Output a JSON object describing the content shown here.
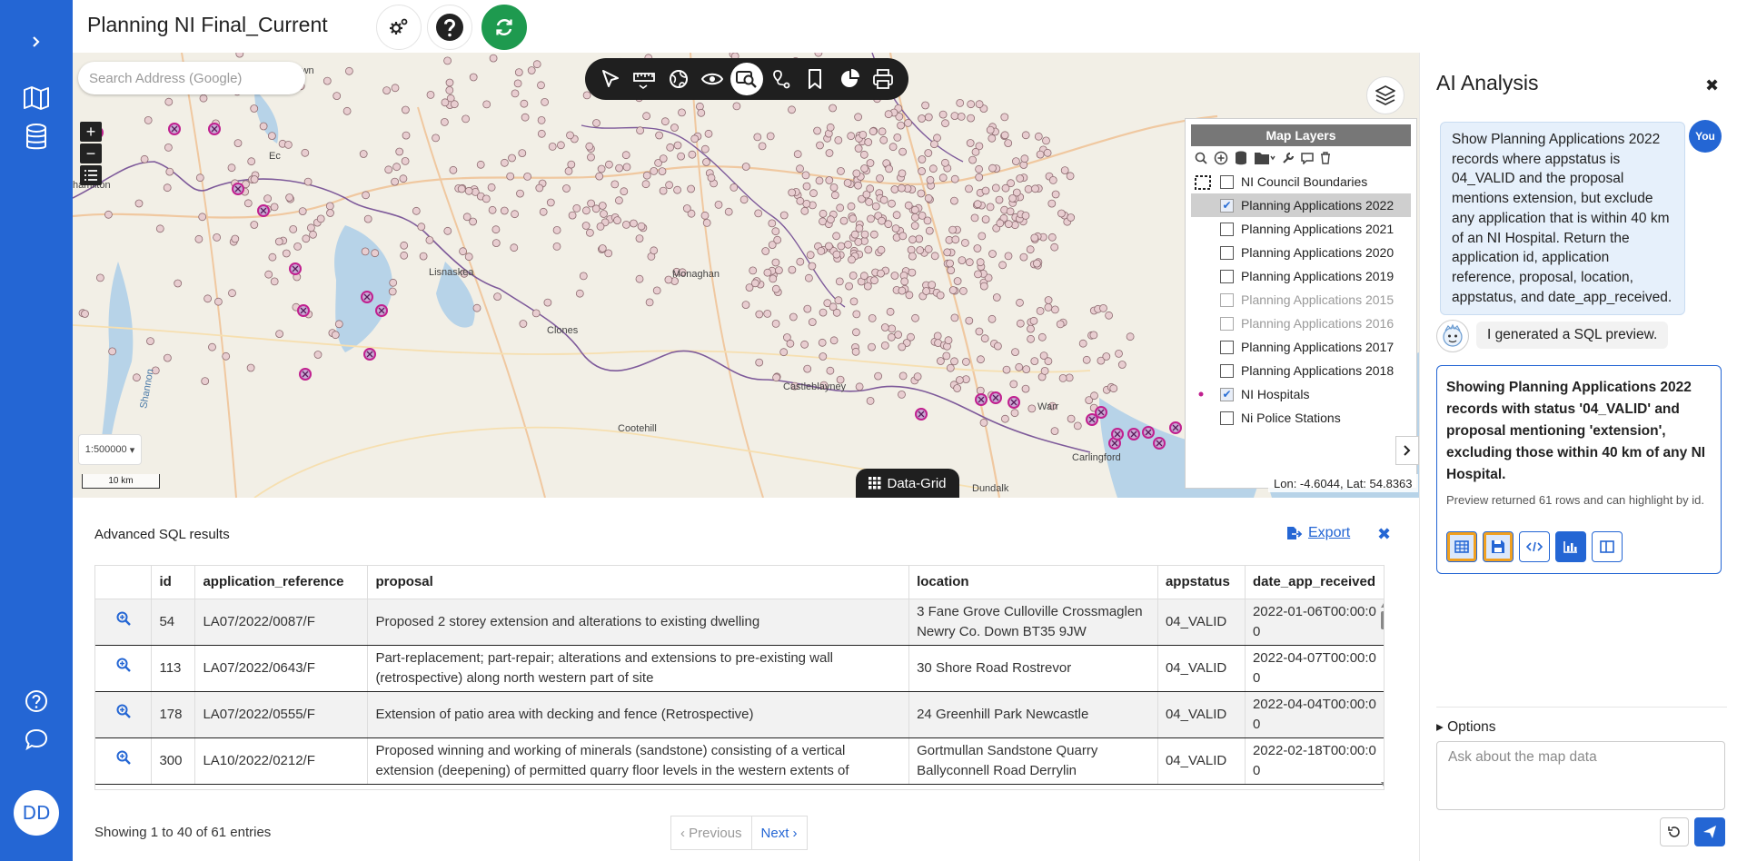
{
  "app": {
    "title": "Planning NI Final_Current",
    "avatar_initials": "DD"
  },
  "colors": {
    "accent": "#2466d4",
    "refresh": "#1e9a4f",
    "hospital": "#c0208f",
    "application_dot": "#e8cdd0"
  },
  "icons": {
    "rail": [
      "chevron-right-icon",
      "map-icon",
      "database-icon",
      "help-icon",
      "chat-icon"
    ],
    "header": [
      "settings-icon",
      "help-icon",
      "refresh-icon"
    ],
    "toolbar": [
      "select-pointer-icon",
      "measure-icon",
      "globe-icon",
      "eye-icon",
      "zoom-search-icon",
      "route-pin-icon",
      "bookmark-icon",
      "pie-chart-icon",
      "print-icon"
    ]
  },
  "map": {
    "search_placeholder": "Search Address (Google)",
    "scale": "1:500000",
    "scale_bar": "10 km",
    "coords": "Lon: -4.6044, Lat: 54.8363",
    "datagrid_label": "Data-Grid",
    "place_labels": [
      {
        "name": "Irvinestown"
      },
      {
        "name": "Ec"
      },
      {
        "name": "hamilton"
      },
      {
        "name": "Lisnaskea"
      },
      {
        "name": "Monaghan"
      },
      {
        "name": "Clones"
      },
      {
        "name": "Castleblayney"
      },
      {
        "name": "Cootehill"
      },
      {
        "name": "Dundalk"
      },
      {
        "name": "Carlingford"
      },
      {
        "name": "Warr"
      },
      {
        "name": "Shannon"
      }
    ]
  },
  "layers": {
    "title": "Map Layers",
    "tool_icons": [
      "search-icon",
      "add-layer-icon",
      "stack-icon",
      "folder-icon",
      "wrench-icon",
      "comment-icon",
      "trash-icon"
    ],
    "items": [
      {
        "label": "NI Council Boundaries",
        "checked": false,
        "dim": false,
        "marker": "boundary"
      },
      {
        "label": "Planning Applications 2022",
        "checked": true,
        "dim": false,
        "selected": true
      },
      {
        "label": "Planning Applications 2021",
        "checked": false,
        "dim": false
      },
      {
        "label": "Planning Applications 2020",
        "checked": false,
        "dim": false
      },
      {
        "label": "Planning Applications 2019",
        "checked": false,
        "dim": false
      },
      {
        "label": "Planning Applications 2015",
        "checked": false,
        "dim": true
      },
      {
        "label": "Planning Applications 2016",
        "checked": false,
        "dim": true
      },
      {
        "label": "Planning Applications 2017",
        "checked": false,
        "dim": false
      },
      {
        "label": "Planning Applications 2018",
        "checked": false,
        "dim": false
      },
      {
        "label": "NI Hospitals",
        "checked": true,
        "dim": false,
        "marker": "dot"
      },
      {
        "label": "Ni Police Stations",
        "checked": false,
        "dim": false
      }
    ]
  },
  "results": {
    "title": "Advanced SQL results",
    "export_label": "Export",
    "columns": [
      "",
      "id",
      "application_reference",
      "proposal",
      "location",
      "appstatus",
      "date_app_received"
    ],
    "rows": [
      {
        "id": "54",
        "application_reference": "LA07/2022/0087/F",
        "proposal": "Proposed 2 storey extension and alterations to existing dwelling",
        "location": "3 Fane Grove Culloville Crossmaglen Newry Co. Down BT35 9JW",
        "appstatus": "04_VALID",
        "date_app_received": "2022-01-06T00:00:00"
      },
      {
        "id": "113",
        "application_reference": "LA07/2022/0643/F",
        "proposal": "Part-replacement; part-repair; alterations and extensions to pre-existing wall (retrospective) along north western part of site",
        "location": "30 Shore Road Rostrevor",
        "appstatus": "04_VALID",
        "date_app_received": "2022-04-07T00:00:00"
      },
      {
        "id": "178",
        "application_reference": "LA07/2022/0555/F",
        "proposal": "Extension of patio area with decking and fence (Retrospective)",
        "location": "24 Greenhill Park Newcastle",
        "appstatus": "04_VALID",
        "date_app_received": "2022-04-04T00:00:00"
      },
      {
        "id": "300",
        "application_reference": "LA10/2022/0212/F",
        "proposal": "Proposed winning and working of minerals (sandstone) consisting of a vertical extension (deepening) of permitted quarry floor levels in the western extents of",
        "location": "Gortmullan Sandstone Quarry Ballyconnell Road Derrylin",
        "appstatus": "04_VALID",
        "date_app_received": "2022-02-18T00:00:00"
      }
    ],
    "showing": "Showing 1 to 40 of 61 entries",
    "prev_label": "Previous",
    "next_label": "Next"
  },
  "ai": {
    "title": "AI Analysis",
    "you_label": "You",
    "user_message": "Show Planning Applications 2022 records where appstatus is 04_VALID and the proposal mentions extension, but exclude any application that is within 40 km of an NI Hospital. Return the application id, application reference, proposal, location, appstatus, and date_app_received.",
    "bot_message": "I generated a SQL preview.",
    "sql_summary": "Showing Planning Applications 2022 records with status '04_VALID' and proposal mentioning 'extension', excluding those within 40 km of any NI Hospital.",
    "sql_note": "Preview returned 61 rows and can highlight by id.",
    "card_button_icons": [
      "table-icon",
      "save-icon",
      "code-icon",
      "chart-icon",
      "split-view-icon"
    ],
    "options_label": "Options",
    "input_placeholder": "Ask about the map data"
  }
}
